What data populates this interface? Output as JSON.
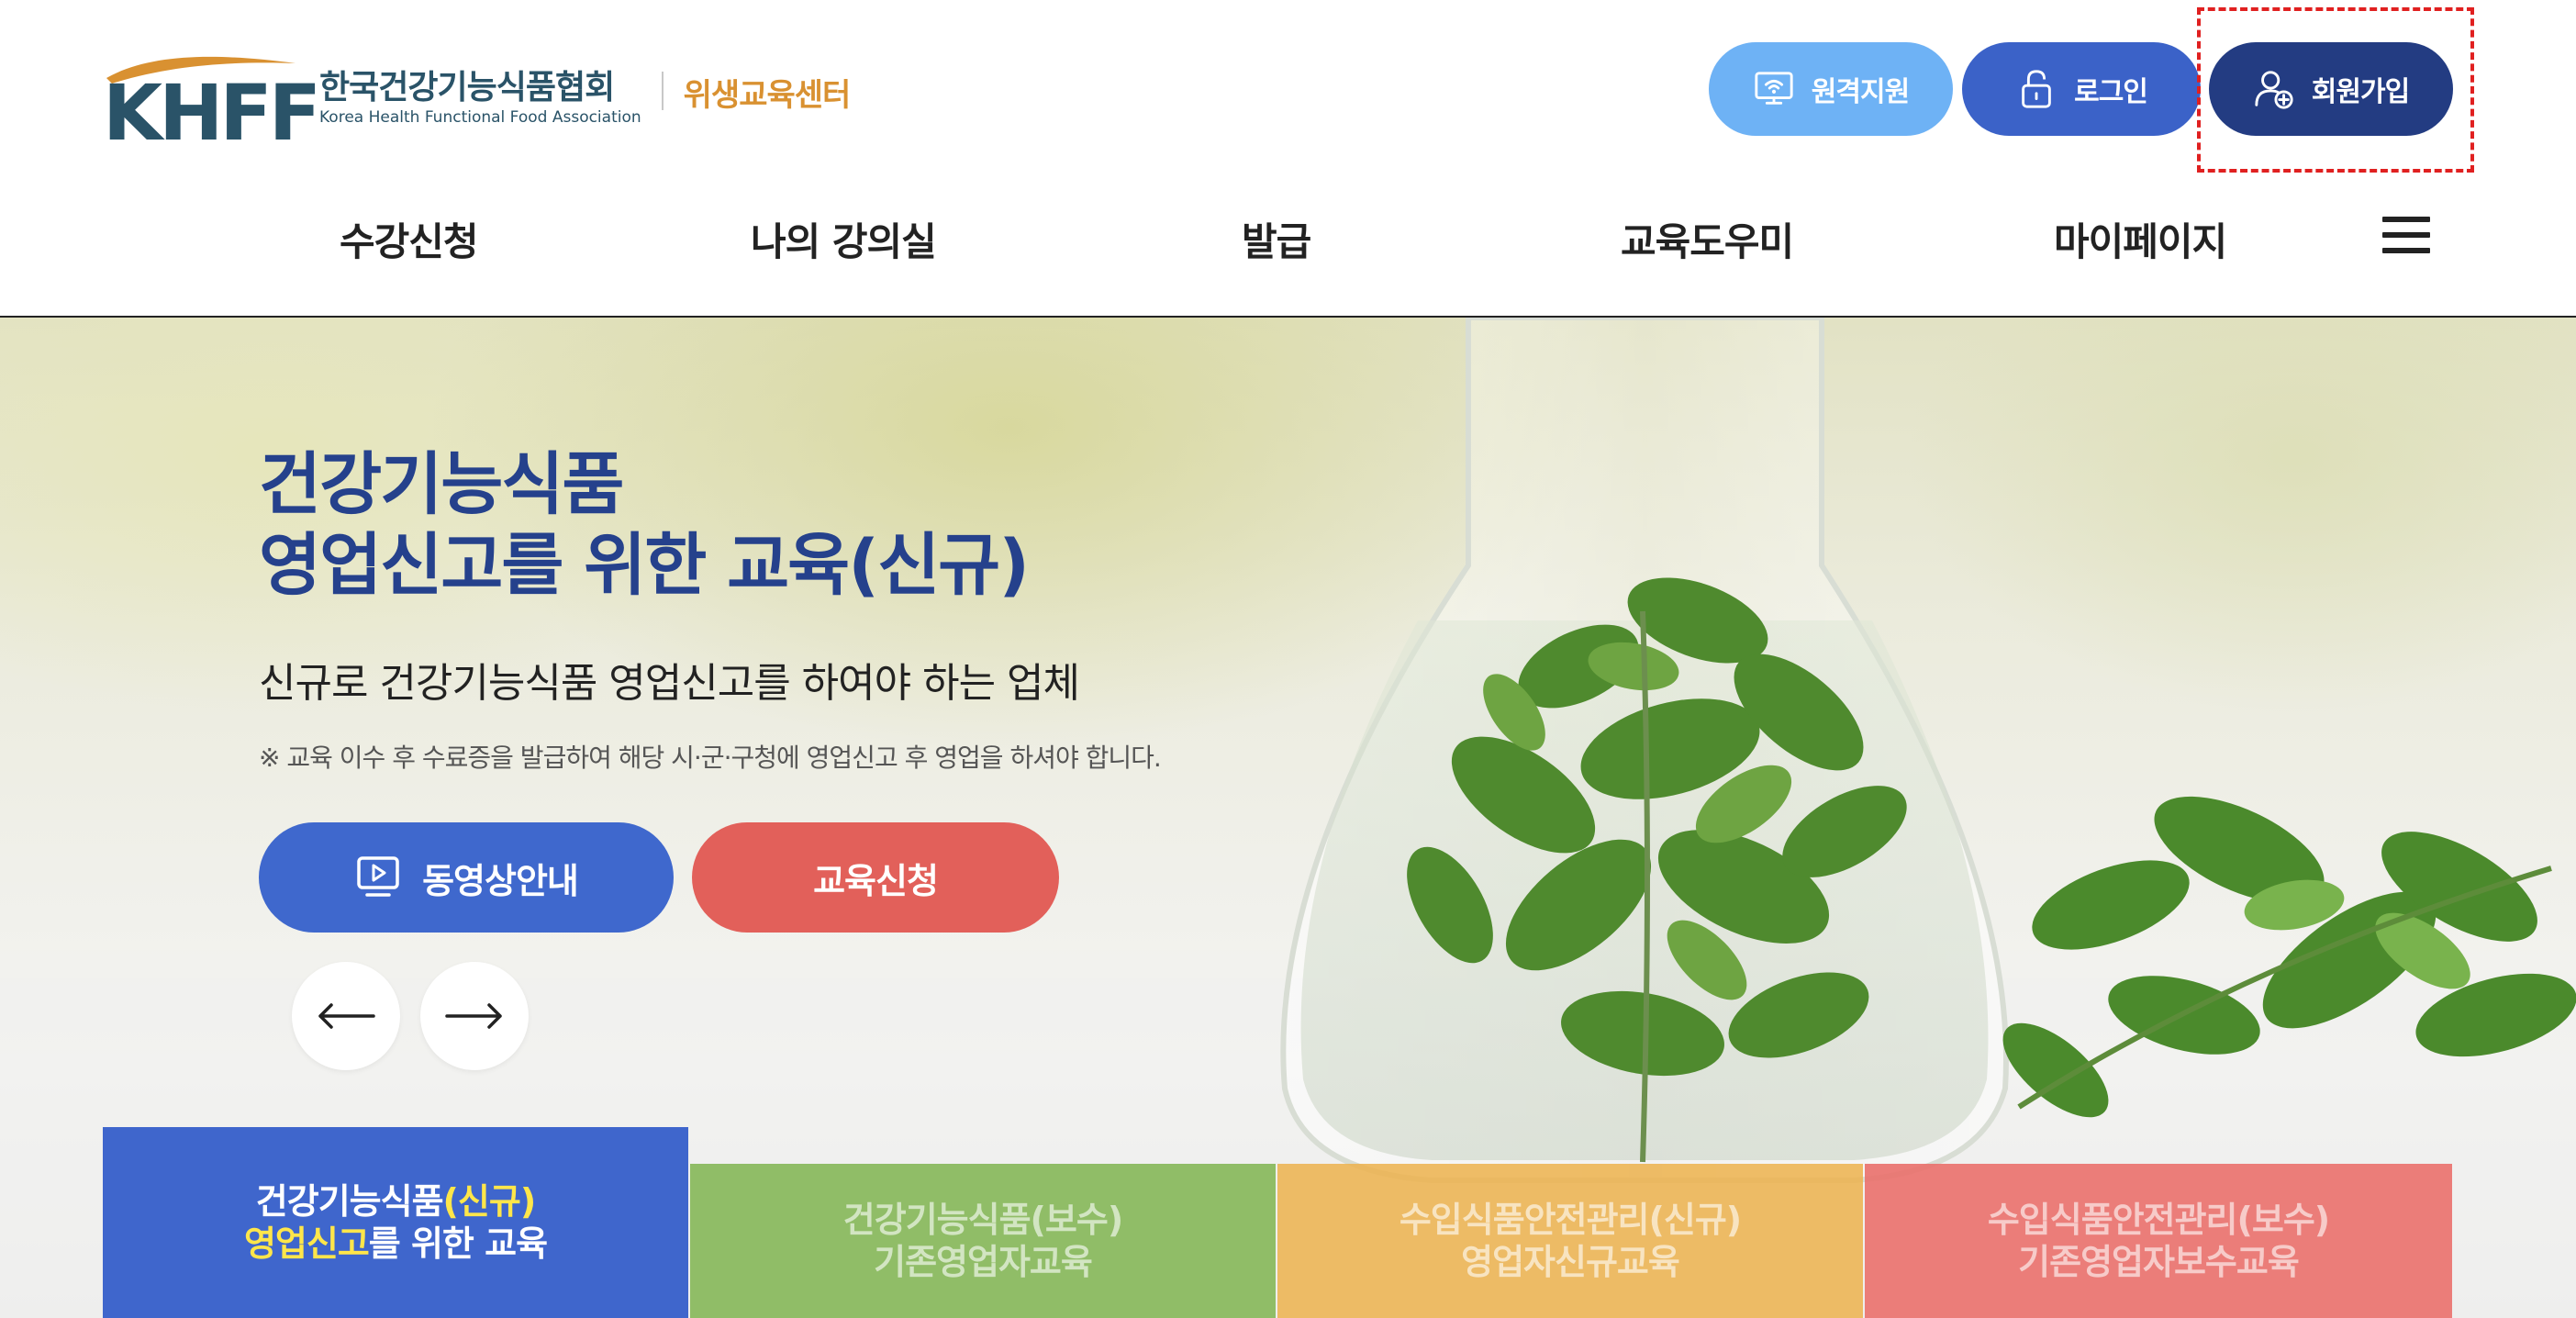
{
  "header": {
    "logo": {
      "mark": "KHFF",
      "name_kr": "한국건강기능식품협회",
      "name_en": "Korea Health Functional Food Association",
      "center": "위생교육센터"
    },
    "buttons": {
      "remote": {
        "label": "원격지원",
        "icon": "monitor-wifi-icon"
      },
      "login": {
        "label": "로그인",
        "icon": "lock-icon"
      },
      "join": {
        "label": "회원가입",
        "icon": "user-add-icon"
      }
    },
    "nav": [
      "수강신청",
      "나의 강의실",
      "발급",
      "교육도우미",
      "마이페이지"
    ]
  },
  "hero": {
    "title_line1": "건강기능식품",
    "title_line2": "영업신고를 위한 교육(신규)",
    "subtitle": "신규로 건강기능식품 영업신고를 하여야 하는 업체",
    "note": "※ 교육 이수 후 수료증을 발급하여 해당 시·군·구청에 영업신고 후 영업을 하셔야 합니다.",
    "video_button": "동영상안내",
    "apply_button": "교육신청"
  },
  "tabs": [
    {
      "line1_a": "건강기능식품",
      "line1_b": "(신규)",
      "line2_a": "영업신고",
      "line2_b": "를 위한 교육"
    },
    {
      "line1": "건강기능식품(보수)",
      "line2": "기존영업자교육"
    },
    {
      "line1": "수입식품안전관리(신규)",
      "line2": "영업자신규교육"
    },
    {
      "line1": "수입식품안전관리(보수)",
      "line2": "기존영업자보수교육"
    }
  ],
  "colors": {
    "brand_navy": "#233c82",
    "brand_blue": "#3b62c8",
    "light_blue": "#6eb2f5",
    "title_blue": "#25418c",
    "apply_red": "#e2605a",
    "logo_orange": "#d99131",
    "tab_green": "#80b450",
    "tab_orange": "#ecb24e",
    "tab_red": "#ea706c",
    "highlight_yellow": "#ffe64a"
  }
}
